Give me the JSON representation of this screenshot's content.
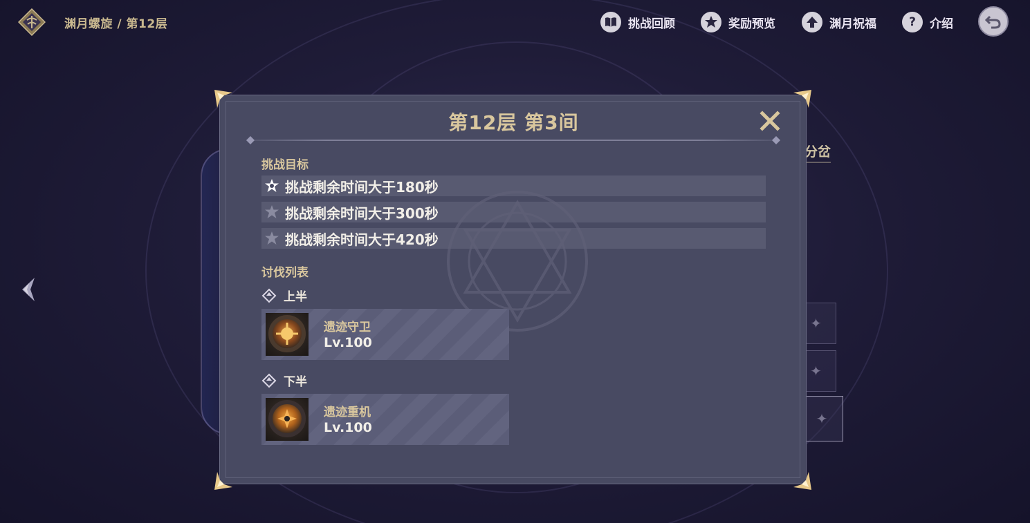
{
  "header": {
    "breadcrumb": "渊月螺旋 / 第12层",
    "nav": [
      {
        "label": "挑战回顾",
        "icon": "book-icon"
      },
      {
        "label": "奖励预览",
        "icon": "star-icon"
      },
      {
        "label": "渊月祝福",
        "icon": "up-arrow-icon"
      },
      {
        "label": "介绍",
        "icon": "question-icon"
      }
    ],
    "back_icon": "back-arrow-icon"
  },
  "background": {
    "side_label": "分岔"
  },
  "modal": {
    "title": "第12层 第3间",
    "goals_heading": "挑战目标",
    "goals": [
      {
        "text": "挑战剩余时间大于180秒",
        "achieved": true
      },
      {
        "text": "挑战剩余时间大于300秒",
        "achieved": false
      },
      {
        "text": "挑战剩余时间大于420秒",
        "achieved": false
      }
    ],
    "enemies_heading": "讨伐列表",
    "halves": [
      {
        "label": "上半",
        "enemy": {
          "name": "遗迹守卫",
          "level": "Lv.100"
        }
      },
      {
        "label": "下半",
        "enemy": {
          "name": "遗迹重机",
          "level": "Lv.100"
        }
      }
    ]
  },
  "colors": {
    "accent_gold": "#d9c79e",
    "modal_bg": "#484a62",
    "star_achieved": "#ffffff",
    "star_unachieved": "#8a8ba0"
  }
}
